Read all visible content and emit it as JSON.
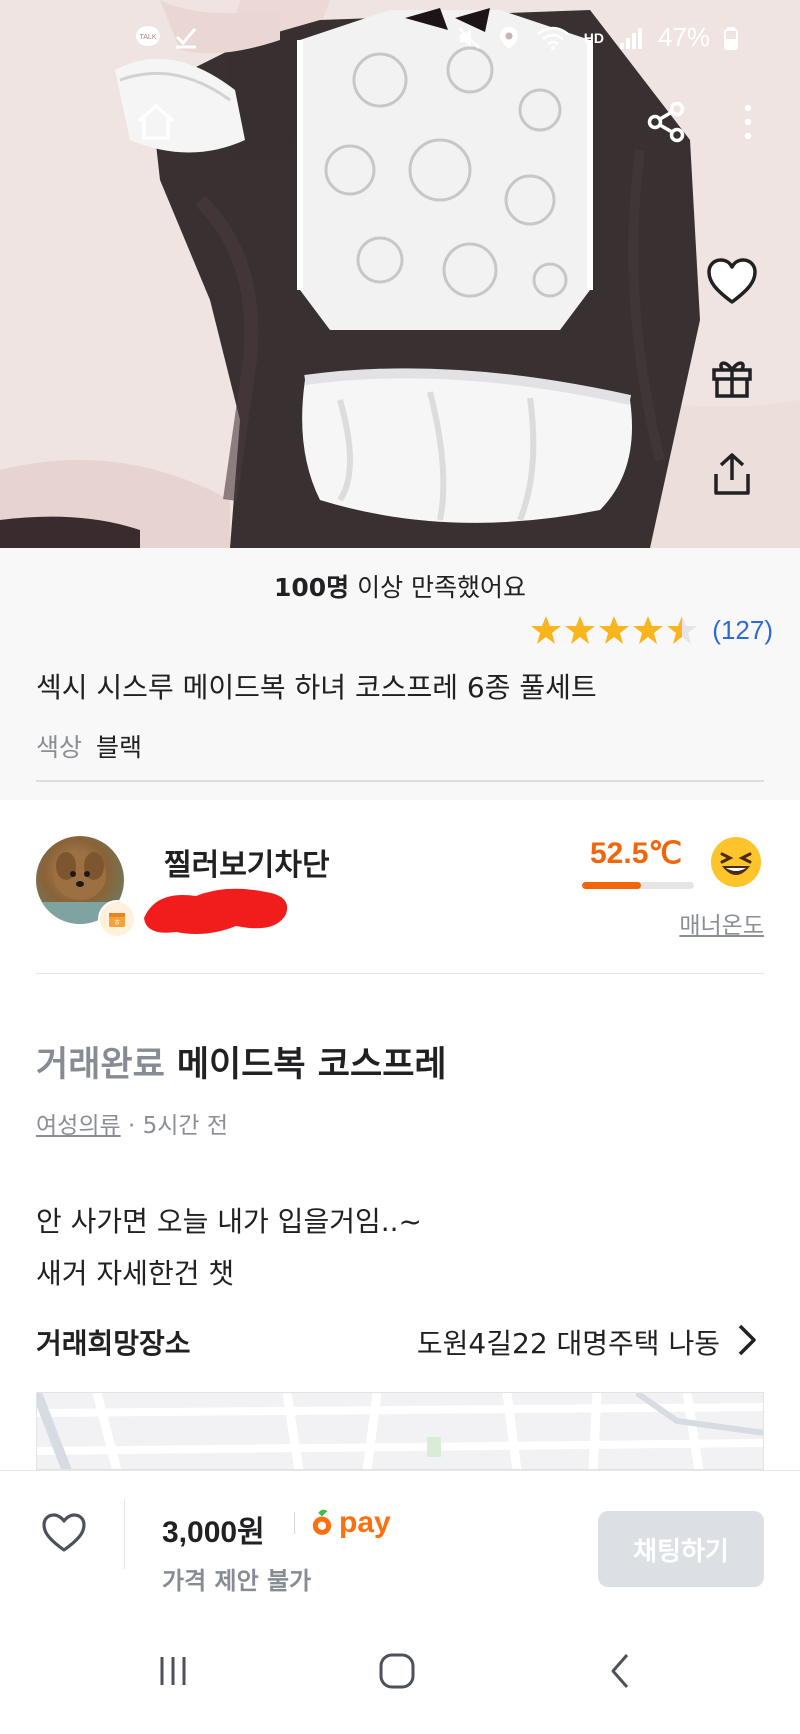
{
  "status_bar": {
    "battery": "47%",
    "network": "HD"
  },
  "product": {
    "satisfied_bold": "100명",
    "satisfied_rest": " 이상 만족했어요",
    "rating": 4.5,
    "rating_count": "(127)",
    "title": "섹시 시스루 메이드복 하녀 코스프레 6종 풀세트",
    "color_label": "색상",
    "color_value": "블랙"
  },
  "seller": {
    "name": "찔러보기차단",
    "manner_temp": "52.5℃",
    "manner_temp_value": 52.5,
    "manner_label": "매너온도"
  },
  "post": {
    "status": "거래완료",
    "title": "메이드복 코스프레",
    "category": "여성의류",
    "time": " · 5시간 전",
    "description_line1": "안 사가면 오늘 내가 입을거임..~",
    "description_line2": "새거 자세한건 챗",
    "place_label": "거래희망장소",
    "place_value": "도원4길22 대명주택 나동"
  },
  "bottom_bar": {
    "price": "3,000원",
    "pay_label": "pay",
    "no_offer": "가격 제안 불가",
    "chat_button": "채팅하기"
  },
  "colors": {
    "accent": "#ff6f0f",
    "temp": "#f2650a",
    "star": "#f8b51e",
    "link": "#2e6bd3"
  },
  "icons": {
    "home": "home-icon",
    "share": "share-icon",
    "more": "more-vertical-icon",
    "heart": "heart-icon",
    "gift": "gift-icon",
    "upload": "upload-icon",
    "chevron": "chevron-right-icon"
  }
}
